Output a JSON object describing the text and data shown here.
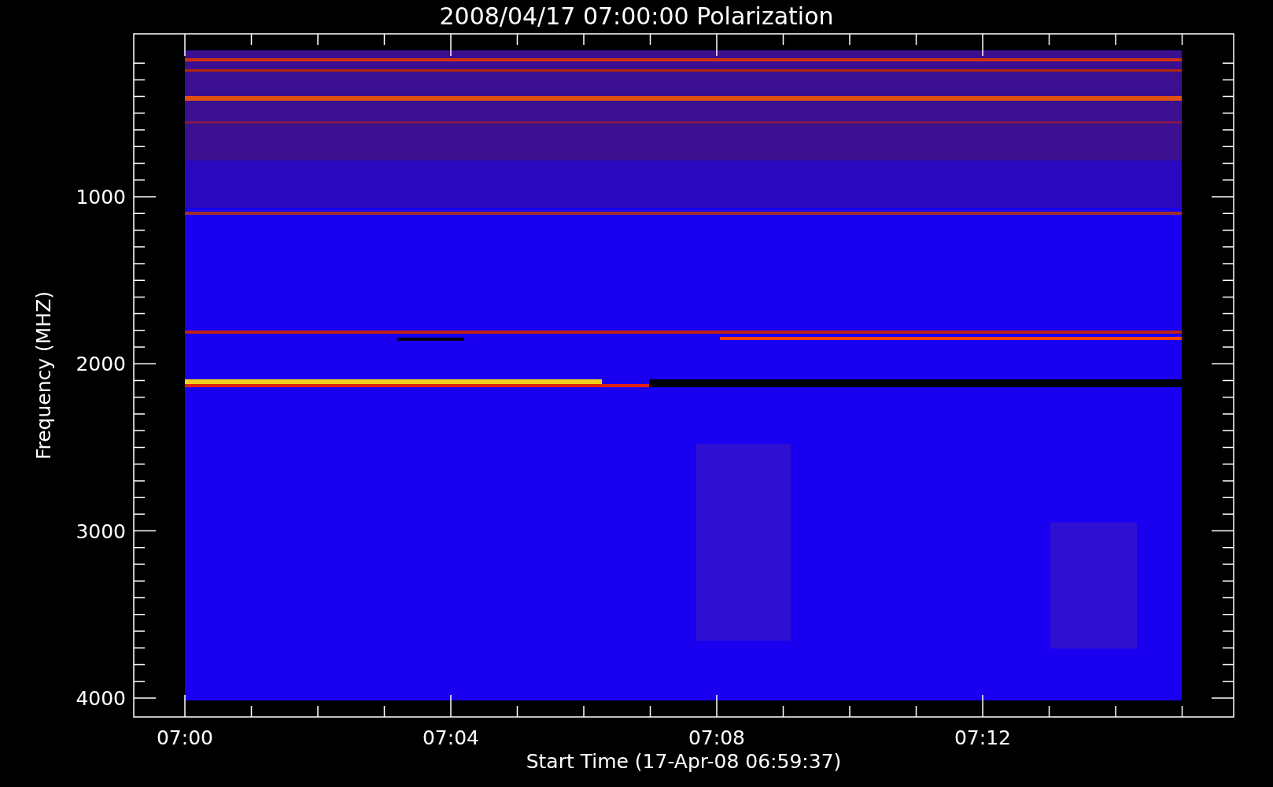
{
  "title": "2008/04/17 07:00:00 Polarization",
  "y_axis": {
    "label": "Frequency (MHZ)",
    "ticks": [
      "1000",
      "2000",
      "3000",
      "4000"
    ]
  },
  "x_axis": {
    "label": "Start Time (17-Apr-08 06:59:37)",
    "ticks": [
      "07:00",
      "07:04",
      "07:08",
      "07:12"
    ]
  }
}
